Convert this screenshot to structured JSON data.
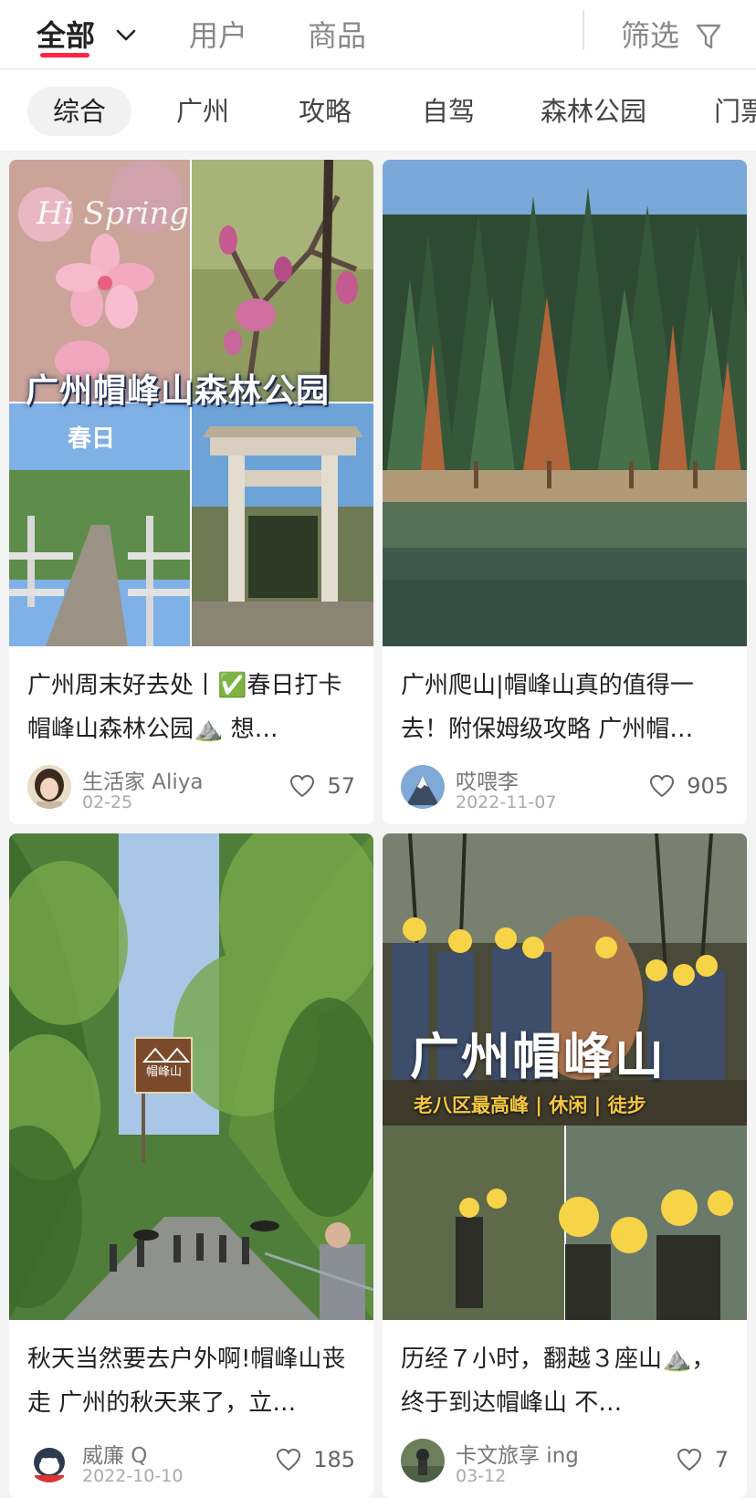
{
  "top_tabs": {
    "all": "全部",
    "users": "用户",
    "goods": "商品",
    "filter": "筛选"
  },
  "chips": [
    "综合",
    "广州",
    "攻略",
    "自驾",
    "森林公园",
    "门票"
  ],
  "cards": [
    {
      "title": "广州周末好去处丨✅春日打卡帽峰山森林公园⛰️ 想…",
      "author": "生活家 Aliya",
      "date": "02-25",
      "likes": "57",
      "overlay": {
        "big": "广州帽峰山森林公园",
        "small": "春日",
        "hi": "Hi Spring"
      }
    },
    {
      "title": "广州爬山|帽峰山真的值得一去！附保姆级攻略 广州帽…",
      "author": "哎喂李",
      "date": "2022-11-07",
      "likes": "905"
    },
    {
      "title": "秋天当然要去户外啊!帽峰山丧走 广州的秋天来了，立…",
      "author": "威廉 Q",
      "date": "2022-10-10",
      "likes": "185",
      "overlay": {
        "sign": "帽峰山"
      }
    },
    {
      "title": "历经７小时，翻越３座山⛰️，终于到达帽峰山 不…",
      "author": "卡文旅享 ing",
      "date": "03-12",
      "likes": "7",
      "overlay": {
        "big": "广州帽峰山",
        "small": "老八区最高峰 | 休闲 | 徒步"
      }
    }
  ],
  "colors": {
    "accent": "#ff2442"
  }
}
